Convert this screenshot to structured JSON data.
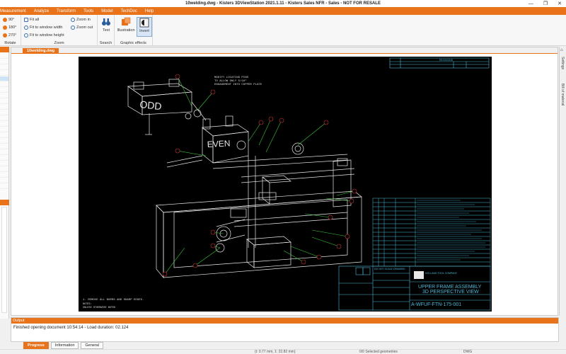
{
  "window": {
    "title": "10welding.dwg - Kisters 3DViewStation 2021.1.11 - Kisters Sales NFR - Sales - NOT FOR RESALE",
    "buttons": [
      "—",
      "❐",
      "✕"
    ]
  },
  "menu": [
    "Measurement",
    "Analyze",
    "Transform",
    "Tools",
    "Model",
    "TechDoc",
    "Help"
  ],
  "ribbon": {
    "rotate": {
      "label": "Rotate",
      "items": [
        "90°",
        "180°",
        "270°"
      ]
    },
    "zoom": {
      "label": "Zoom",
      "items": [
        "Fit all",
        "Fit to window width",
        "Fit to window height",
        "Zoom in",
        "Zoom out"
      ]
    },
    "search": {
      "label": "Search",
      "text": "Text"
    },
    "graphic": {
      "label": "Graphic effects",
      "illustration": "Illustration",
      "invert": "Invert"
    }
  },
  "document_tab": "10welding.dwg",
  "drawing": {
    "note1": "MODIFY LOCATING PINS",
    "note2": "TO ALLOW ONLY 5/16\"",
    "note3": "ENGAGEMENT INTO COPPER PLATE",
    "odd": "ODD",
    "even": "EVEN",
    "notes_title": "NOTES:",
    "notes_1": "1. REMOVE ALL BURRS AND SHARP EDGES.",
    "notes_2": "UNLESS OTHERWISE NOTED",
    "title_1": "UPPER FRAME ASSEMBLY",
    "title_2": "3D PERSPECTIVE VIEW",
    "dwg_no": "A-WFUF-FTN-175-001",
    "company": "HOLLAND TOOL COMPANY",
    "dnsd": "DO NOT SCALE DRAWING",
    "revision": "REVISIONS"
  },
  "right_tabs": [
    "Settings",
    "Bill of material"
  ],
  "output": {
    "header": "Output",
    "message": "Finished opening document 10:54:14 - Load duration: 02.124"
  },
  "bottom_tabs": [
    "Progress",
    "Information",
    "General"
  ],
  "status": {
    "coords": "(t: 0.77 mm, 1: 22.82 mm)",
    "selected": "0/0 Selected geometries",
    "format": "DWG"
  }
}
